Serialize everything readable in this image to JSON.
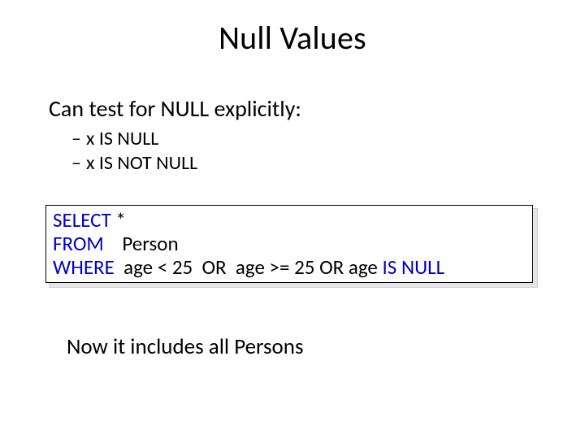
{
  "title": "Null Values",
  "intro": "Can test for NULL explicitly:",
  "subitems": [
    "x IS NULL",
    "x IS NOT NULL"
  ],
  "code": {
    "l1_kw": "SELECT",
    "l1_rest": " *",
    "l2_kw": "FROM",
    "l2_rest": "    Person",
    "l3_kw": "WHERE",
    "l3_mid": "  age < 25  OR  age >= 25 OR age ",
    "l3_tail": "IS NULL"
  },
  "footer": "Now it includes all Persons"
}
